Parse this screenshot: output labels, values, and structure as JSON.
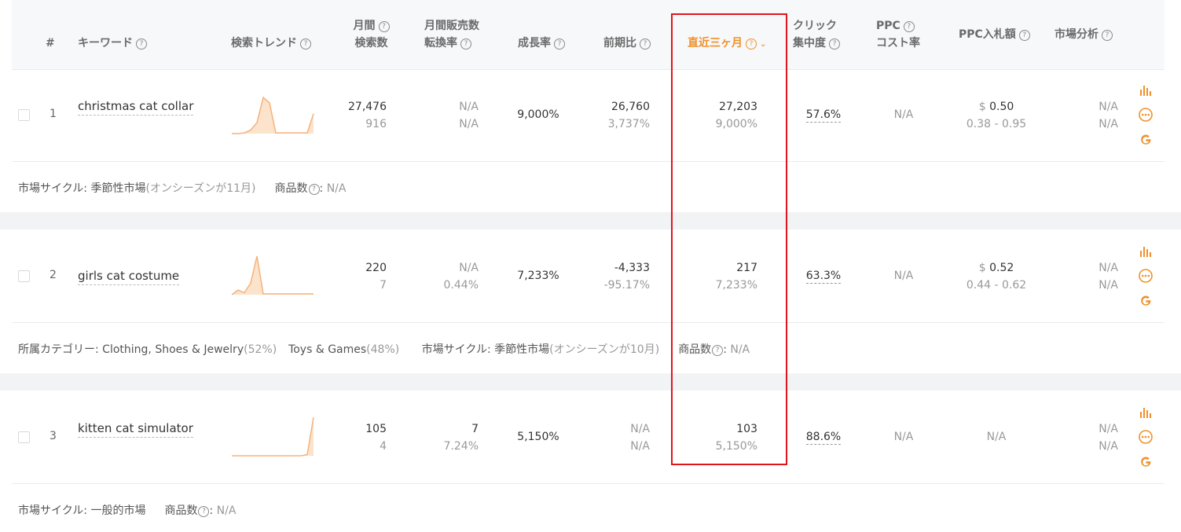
{
  "header": {
    "col_num": "#",
    "col_keyword": "キーワード",
    "col_trend": "検索トレンド",
    "col_monthly_search_1": "月間",
    "col_monthly_search_2": "検索数",
    "col_sales_conv_1": "月間販売数",
    "col_sales_conv_2": "転換率",
    "col_growth": "成長率",
    "col_prev": "前期比",
    "col_recent3m": "直近三ヶ月",
    "col_click_1": "クリック",
    "col_click_2": "集中度",
    "col_ppc_cost_1": "PPC",
    "col_ppc_cost_2": "コスト率",
    "col_ppc_bid": "PPC入札額",
    "col_market": "市場分析",
    "help_glyph": "?",
    "sort_glyph": "⌄"
  },
  "rows": [
    {
      "index": "1",
      "keyword": "christmas cat collar",
      "trend": [
        0,
        0,
        0.02,
        0.1,
        0.3,
        1.0,
        0.85,
        0.02,
        0.02,
        0.02,
        0.02,
        0.02,
        0.02,
        0.55
      ],
      "monthly_search": "27,476",
      "monthly_search_sub": "916",
      "sales": "N/A",
      "conversion": "N/A",
      "growth": "9,000%",
      "prev": "26,760",
      "prev_sub": "3,737%",
      "recent3m": "27,203",
      "recent3m_sub": "9,000%",
      "click_concentration": "57.6%",
      "ppc_cost_rate": "N/A",
      "ppc_bid_symbol": "$",
      "ppc_bid": "0.50",
      "ppc_bid_range": "0.38 - 0.95",
      "market_1": "N/A",
      "market_2": "N/A",
      "meta": {
        "cycle_label": "市場サイクル: ",
        "cycle_value": "季節性市場",
        "cycle_note": "(オンシーズンが11月)",
        "products_label": "商品数",
        "products_glyph": "?",
        "products_sep": ": ",
        "products_value": "N/A"
      }
    },
    {
      "index": "2",
      "keyword": "girls cat costume",
      "trend": [
        0,
        0.12,
        0.05,
        0.3,
        1.0,
        0.02,
        0.02,
        0.02,
        0.02,
        0.02,
        0.02,
        0.02,
        0.02,
        0.02
      ],
      "monthly_search": "220",
      "monthly_search_sub": "7",
      "sales": "N/A",
      "conversion": "0.44%",
      "growth": "7,233%",
      "prev": "-4,333",
      "prev_sub": "-95.17%",
      "recent3m": "217",
      "recent3m_sub": "7,233%",
      "click_concentration": "63.3%",
      "ppc_cost_rate": "N/A",
      "ppc_bid_symbol": "$",
      "ppc_bid": "0.52",
      "ppc_bid_range": "0.44 - 0.62",
      "market_1": "N/A",
      "market_2": "N/A",
      "meta": {
        "category_label": "所属カテゴリー: ",
        "cat1": "Clothing, Shoes & Jewelry",
        "cat1_pct": "(52%)",
        "cat2": "Toys & Games",
        "cat2_pct": "(48%)",
        "cycle_label": "市場サイクル: ",
        "cycle_value": "季節性市場",
        "cycle_note": "(オンシーズンが10月)",
        "products_label": "商品数",
        "products_glyph": "?",
        "products_sep": ": ",
        "products_value": "N/A"
      }
    },
    {
      "index": "3",
      "keyword": "kitten cat simulator",
      "trend": [
        0,
        0,
        0,
        0,
        0,
        0,
        0,
        0,
        0,
        0,
        0,
        0,
        0.03,
        1.0
      ],
      "monthly_search": "105",
      "monthly_search_sub": "4",
      "sales": "7",
      "conversion": "7.24%",
      "growth": "5,150%",
      "prev": "N/A",
      "prev_sub": "N/A",
      "recent3m": "103",
      "recent3m_sub": "5,150%",
      "click_concentration": "88.6%",
      "ppc_cost_rate": "N/A",
      "ppc_bid_plain": "N/A",
      "market_1": "N/A",
      "market_2": "N/A",
      "meta": {
        "cycle_label": "市場サイクル: ",
        "cycle_value": "一般的市場",
        "products_label": "商品数",
        "products_glyph": "?",
        "products_sep": ": ",
        "products_value": "N/A"
      }
    }
  ],
  "colors": {
    "accent": "#f0902a",
    "highlight_box": "#e0151b",
    "spark_line": "#f5b27a",
    "spark_fill": "#fbe3cc"
  },
  "icons": [
    "bar-chart-icon",
    "more-circle-icon",
    "google-icon"
  ]
}
